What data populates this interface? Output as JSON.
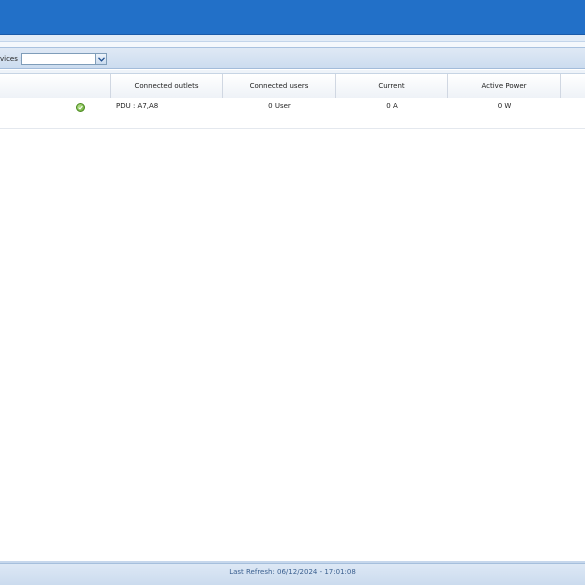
{
  "filter": {
    "label": "vices :",
    "selected_value": ""
  },
  "table": {
    "columns": [
      "",
      "Connected outlets",
      "Connected users",
      "Current",
      "Active Power",
      ""
    ],
    "rows": [
      {
        "status": "ok",
        "connected_outlets": "PDU : A7,A8",
        "connected_users": "0 User",
        "current": "0 A",
        "active_power": "0 W"
      }
    ]
  },
  "footer": {
    "last_refresh": "Last Refresh: 06/12/2024 - 17:01:08"
  },
  "colors": {
    "title_bar": "#2270c8",
    "status_ok": "#5ea52a"
  },
  "icons": {
    "status": "check-circle-icon",
    "dropdown": "chevron-down-icon"
  }
}
